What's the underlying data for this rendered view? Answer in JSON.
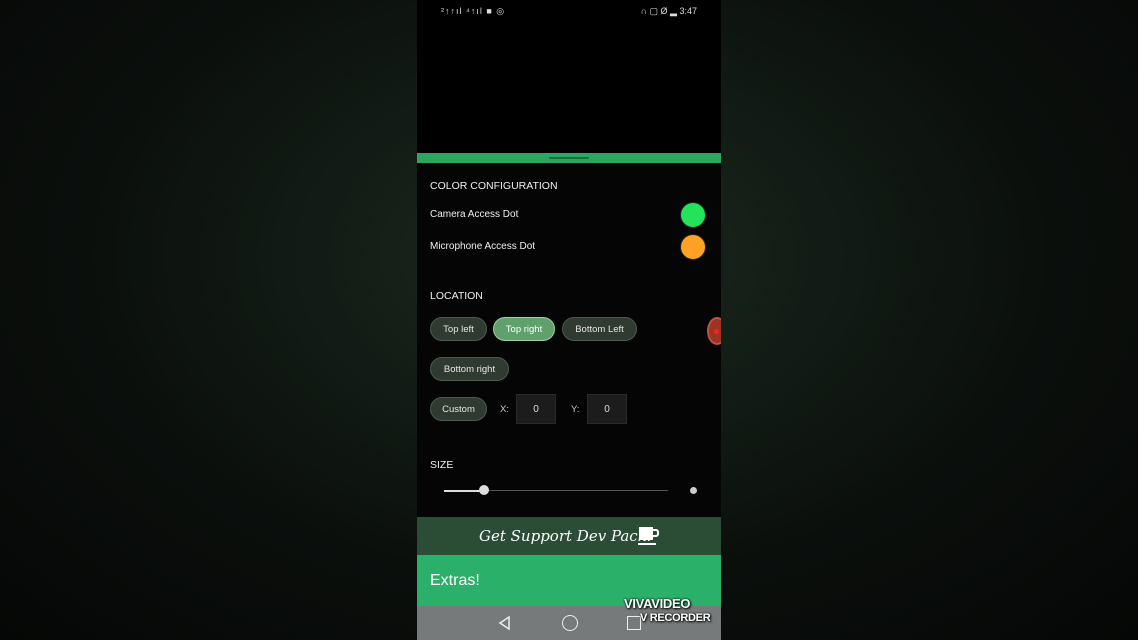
{
  "status_bar": {
    "left": "²↑↑ıl ⁴↑ıl ■ ◎",
    "right": "∩ ▢ Ø ▂ 3:47"
  },
  "color_config": {
    "title": "COLOR CONFIGURATION",
    "items": [
      {
        "label": "Camera Access Dot",
        "color": "#22e35a"
      },
      {
        "label": "Microphone Access Dot",
        "color": "#ffa124"
      }
    ]
  },
  "location": {
    "title": "LOCATION",
    "options": [
      "Top left",
      "Top right",
      "Bottom Left",
      "Bottom right",
      "Custom"
    ],
    "selected": "Top right",
    "x_label": "X:",
    "x_value": "0",
    "y_label": "Y:",
    "y_value": "0"
  },
  "size": {
    "title": "SIZE",
    "value_fraction": 0.18
  },
  "banner": {
    "text": "Get Support Dev Pack!",
    "icon": "coffee-cup-icon"
  },
  "extras": {
    "text": "Extras!"
  },
  "nav": {
    "back": "back-icon",
    "home": "home-icon",
    "recents": "recents-icon"
  },
  "watermark": {
    "line1": "VIVAVIDEO",
    "line2": "V RECORDER"
  },
  "colors": {
    "accent": "#2aa861",
    "extras_bg": "#2bb06a",
    "banner_bg": "#2b4d35"
  }
}
